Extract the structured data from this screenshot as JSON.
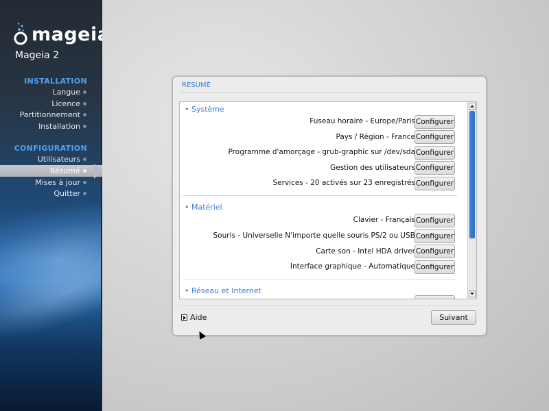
{
  "sidebar": {
    "logo_text": "mageia",
    "product": "Mageia 2",
    "installation": {
      "title": "INSTALLATION",
      "steps": [
        {
          "label": "Langue"
        },
        {
          "label": "Licence"
        },
        {
          "label": "Partitionnement"
        },
        {
          "label": "Installation"
        }
      ]
    },
    "configuration": {
      "title": "CONFIGURATION",
      "steps": [
        {
          "label": "Utilisateurs"
        },
        {
          "label": "Résumé"
        },
        {
          "label": "Mises à jour"
        },
        {
          "label": "Quitter"
        }
      ],
      "active": "Résumé"
    }
  },
  "dialog": {
    "title": "RÉSUMÉ",
    "sections": [
      {
        "header": "• Système",
        "rows": [
          {
            "label": "Fuseau horaire - Europe/Paris",
            "button": "Configurer"
          },
          {
            "label": "Pays / Région - France",
            "button": "Configurer"
          },
          {
            "label": "Programme d'amorçage - grub-graphic sur /dev/sda",
            "button": "Configurer"
          },
          {
            "label": "Gestion des utilisateurs",
            "button": "Configurer"
          },
          {
            "label": "Services - 20 activés sur 23 enregistrés",
            "button": "Configurer"
          }
        ]
      },
      {
        "header": "• Matériel",
        "rows": [
          {
            "label": "Clavier - Français",
            "button": "Configurer"
          },
          {
            "label": "Souris - Universelle N'importe quelle souris PS/2 ou USB",
            "button": "Configurer"
          },
          {
            "label": "Carte son - Intel HDA driver",
            "button": "Configurer"
          },
          {
            "label": "Interface graphique - Automatique",
            "button": "Configurer"
          }
        ]
      },
      {
        "header": "• Réseau et Internet",
        "rows": []
      }
    ],
    "help_label": "Aide",
    "next_label": "Suivant"
  },
  "colors": {
    "accent": "#3d7fd1",
    "sidebar_section": "#4ea3ef",
    "scroll_thumb": "#3579cc"
  }
}
